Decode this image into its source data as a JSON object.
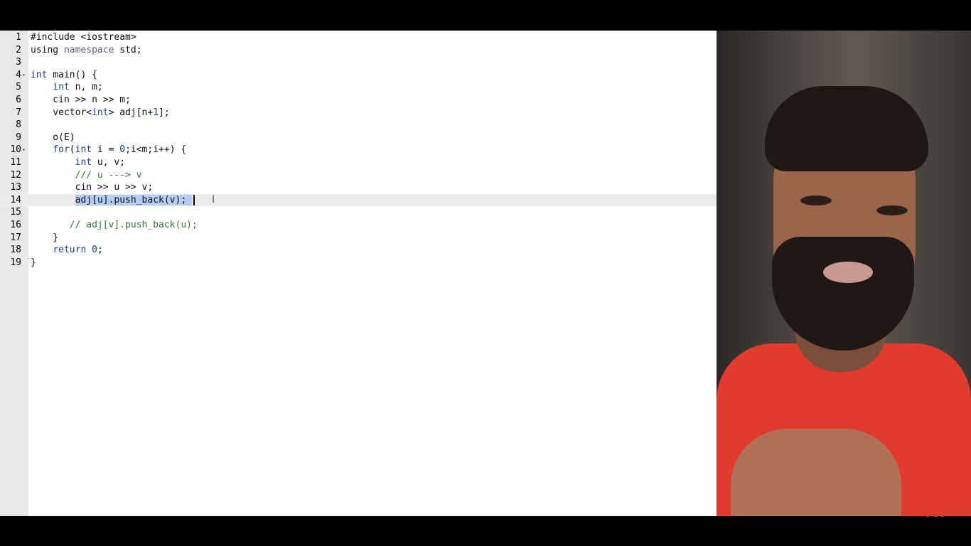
{
  "editor": {
    "lines": [
      {
        "n": "1",
        "code": "#include <iostream>"
      },
      {
        "n": "2",
        "code": "using namespace std;"
      },
      {
        "n": "3",
        "code": ""
      },
      {
        "n": "4",
        "code": "int main() {"
      },
      {
        "n": "5",
        "code": "    int n, m;"
      },
      {
        "n": "6",
        "code": "    cin >> n >> m;"
      },
      {
        "n": "7",
        "code": "    vector<int> adj[n+1];"
      },
      {
        "n": "8",
        "code": ""
      },
      {
        "n": "9",
        "code": "    o(E)"
      },
      {
        "n": "10",
        "code": "    for(int i = 0;i<m;i++) {"
      },
      {
        "n": "11",
        "code": "        int u, v;"
      },
      {
        "n": "12",
        "code": "        /// u ---> v"
      },
      {
        "n": "13",
        "code": "        cin >> u >> v;"
      },
      {
        "n": "14",
        "code": "        adj[u].push_back(v);"
      },
      {
        "n": "15",
        "code": ""
      },
      {
        "n": "16",
        "code": "       // adj[v].push_back(u);"
      },
      {
        "n": "17",
        "code": "    }"
      },
      {
        "n": "18",
        "code": "    return 0;"
      },
      {
        "n": "19",
        "code": "}"
      }
    ],
    "current_line": "14",
    "selected_text": "adj[u].push_back(v);"
  },
  "webcam": {
    "watermark": "TUF"
  },
  "colors": {
    "keyword": "#1b3aa8",
    "comment": "#2e7d32",
    "selection": "#b5cdf2",
    "brand": "#e23b2e"
  }
}
